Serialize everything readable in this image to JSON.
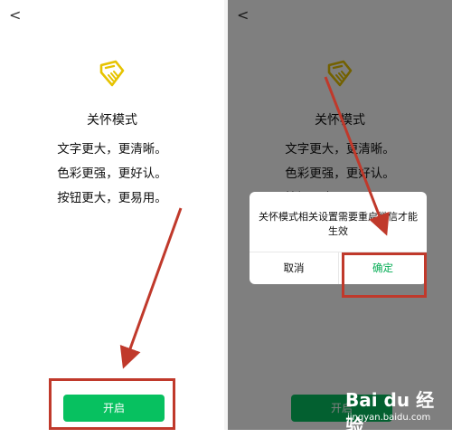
{
  "left": {
    "back": "<",
    "title": "关怀模式",
    "lines": [
      "文字更大，更清晰。",
      "色彩更强，更好认。",
      "按钮更大，更易用。"
    ],
    "open_button": "开启"
  },
  "right": {
    "back": "<",
    "title": "关怀模式",
    "lines": [
      "文字更大，更清晰。",
      "色彩更强，更好认。",
      "按钮更大，更易用。"
    ],
    "open_button": "开启",
    "dialog": {
      "message": "关怀模式相关设置需要重启微信才能生效",
      "cancel": "取消",
      "confirm": "确定"
    }
  },
  "watermark": {
    "logo": "Bai du 经验",
    "site": "jingyan.baidu.com"
  },
  "colors": {
    "primary": "#07c160",
    "annotation": "#c0392b",
    "logo_yellow": "#e6c300"
  }
}
